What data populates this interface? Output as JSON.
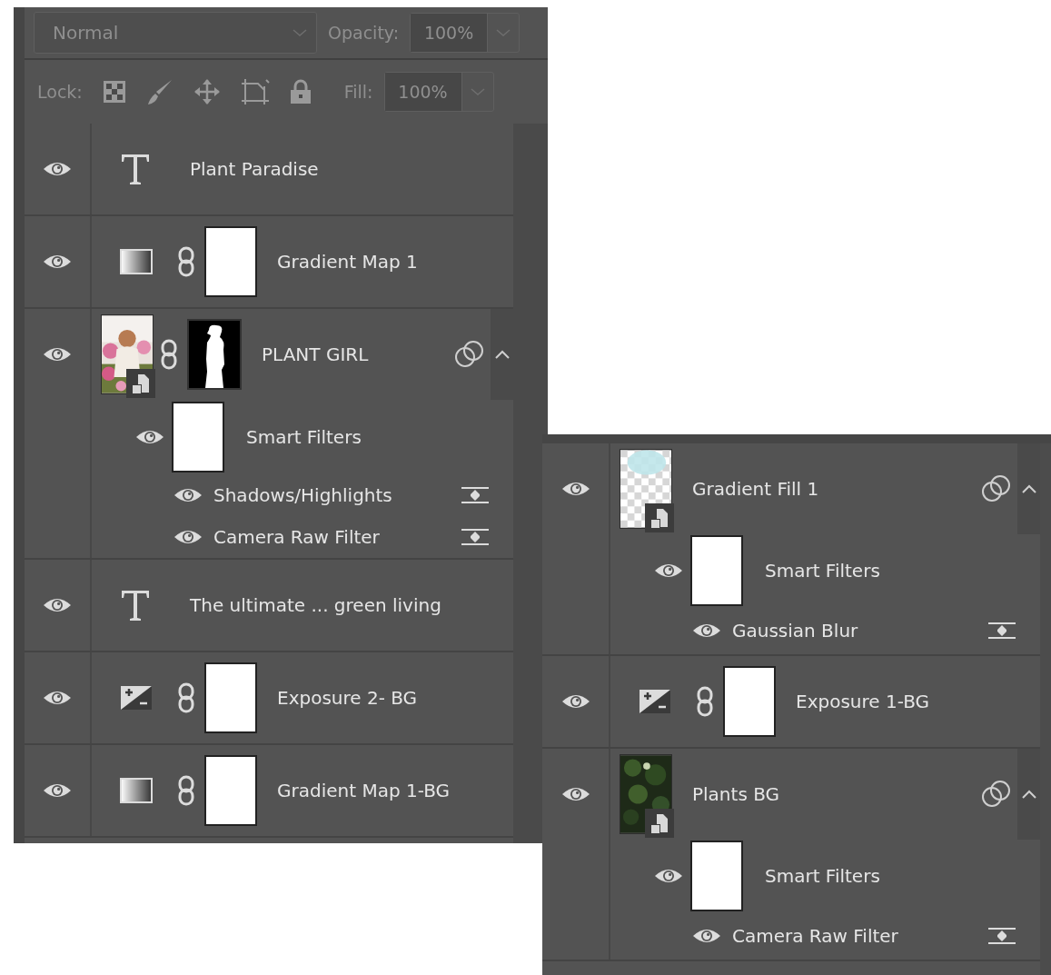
{
  "panels": [
    {
      "header": {
        "blend_mode": "Normal",
        "opacity_label": "Opacity:",
        "opacity": "100%",
        "lock_label": "Lock:",
        "fill_label": "Fill:",
        "fill": "100%"
      },
      "layers": [
        {
          "kind": "text",
          "name": "Plant Paradise",
          "visible": true
        },
        {
          "kind": "gradient_map",
          "mask": {
            "kind": "white"
          },
          "name": "Gradient Map 1",
          "visible": true
        },
        {
          "kind": "smart_object",
          "mask": {
            "kind": "silhouette"
          },
          "name": "PLANT GIRL",
          "visible": true,
          "effects": true,
          "expanded": true,
          "smart_filters": {
            "label": "Smart Filters",
            "visible": true,
            "filters": [
              {
                "name": "Shadows/Highlights",
                "visible": true
              },
              {
                "name": "Camera Raw Filter",
                "visible": true
              }
            ]
          }
        },
        {
          "kind": "text",
          "name": "The ultimate ... green living",
          "visible": true
        },
        {
          "kind": "exposure",
          "mask": {
            "kind": "white"
          },
          "name": "Exposure 2- BG",
          "visible": true
        },
        {
          "kind": "gradient_map",
          "mask": {
            "kind": "white"
          },
          "name": "Gradient Map 1-BG",
          "visible": true
        }
      ]
    },
    {
      "layers": [
        {
          "kind": "smart_object",
          "thumbnail": {
            "kind": "transparency"
          },
          "name": "Gradient Fill 1",
          "visible": true,
          "effects": true,
          "expanded": true,
          "smart_filters": {
            "label": "Smart Filters",
            "visible": true,
            "filters": [
              {
                "name": "Gaussian Blur",
                "visible": true
              }
            ]
          }
        },
        {
          "kind": "exposure",
          "mask": {
            "kind": "white"
          },
          "name": "Exposure 1-BG",
          "visible": true
        },
        {
          "kind": "smart_object",
          "name": "Plants BG",
          "visible": true,
          "effects": true,
          "expanded": true,
          "smart_filters": {
            "label": "Smart Filters",
            "visible": true,
            "filters": [
              {
                "name": "Camera Raw Filter",
                "visible": true
              }
            ]
          }
        }
      ]
    }
  ]
}
